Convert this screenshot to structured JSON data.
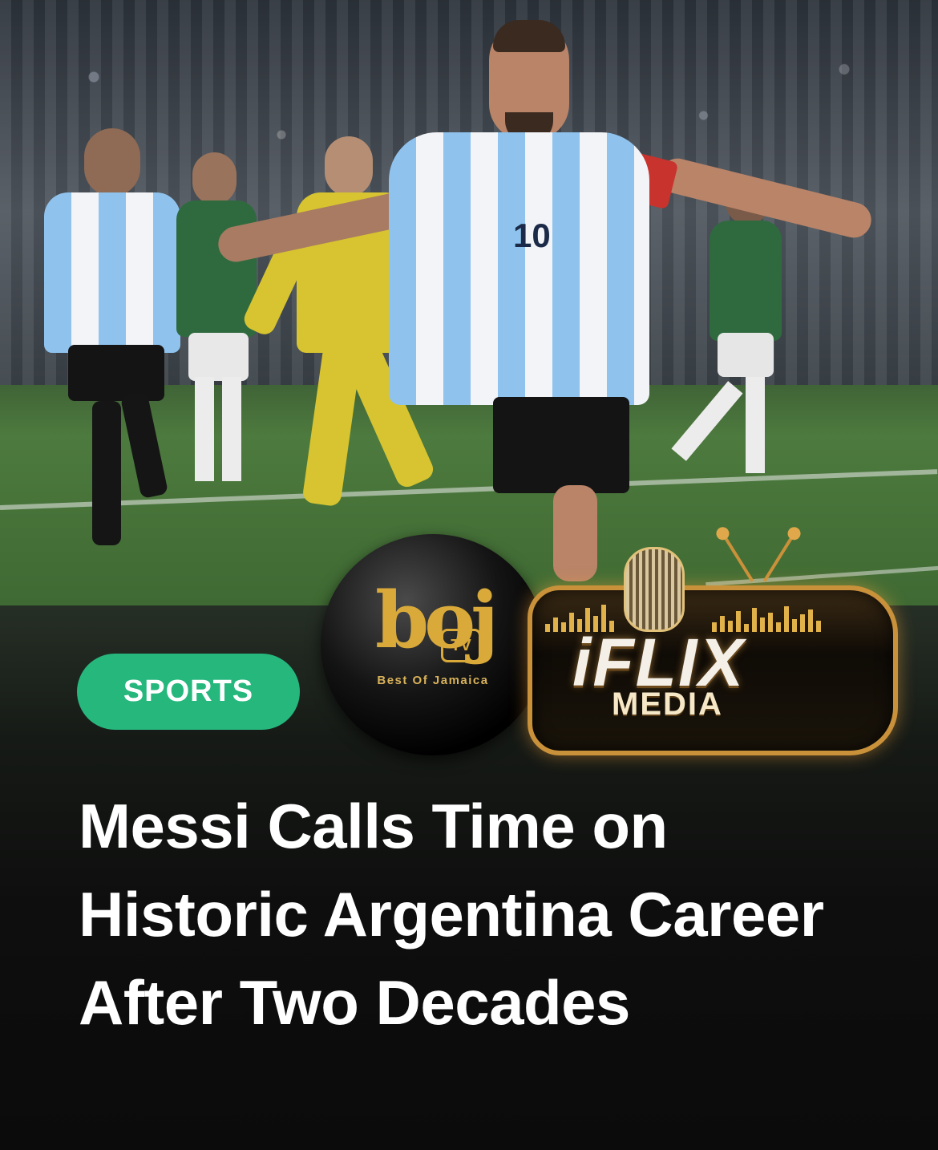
{
  "article": {
    "category": "SPORTS",
    "headline": "Messi Calls Time on Historic Argentina Career After Two Decades"
  },
  "photo": {
    "jersey_number": "10"
  },
  "logos": {
    "boj": {
      "mark": "boj",
      "tv": "TV",
      "tagline": "Best Of Jamaica"
    },
    "iflix": {
      "name": "iFLIX",
      "subtitle": "MEDIA"
    }
  },
  "colors": {
    "category_pill": "#26b77d",
    "headline_text": "#ffffff",
    "background": "#0e0e0e",
    "logo_gold": "#d9a93a"
  }
}
